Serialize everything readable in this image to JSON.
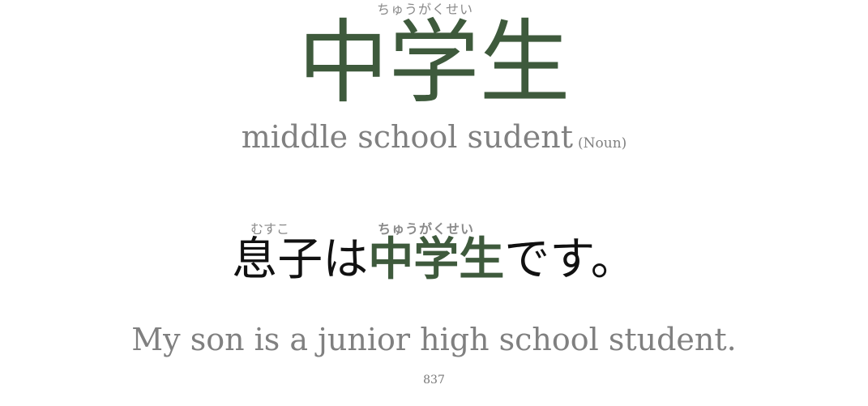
{
  "word": {
    "reading": "ちゅうがくせい",
    "kanji": "中学生",
    "meaning": "middle school sudent",
    "part_of_speech": "(Noun)"
  },
  "sentence": {
    "prefix_reading": "むすこ",
    "prefix": "息子は",
    "highlight_reading": "ちゅうがくせい",
    "highlight": "中学生",
    "suffix": "です。",
    "translation": "My son is a junior high school student."
  },
  "card_number": "837",
  "colors": {
    "highlight": "#3e5a3c",
    "muted": "#808080",
    "text": "#111111"
  }
}
